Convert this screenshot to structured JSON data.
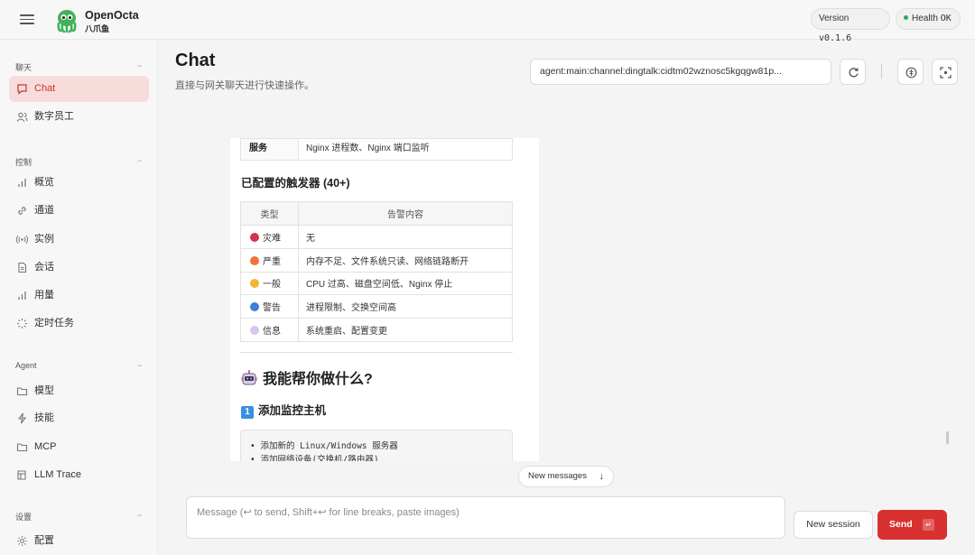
{
  "brand": {
    "name": "OpenOcta",
    "sub": "八爪鱼"
  },
  "status": {
    "version_label": "Version",
    "version_value": "v0.1.6",
    "health_label": "Health",
    "health_value": "OK",
    "health_color": "#2fa65a"
  },
  "sidebar": {
    "sections": [
      {
        "title": "聊天",
        "items": [
          {
            "label": "Chat",
            "icon": "chat-bubble-icon",
            "active": true
          },
          {
            "label": "数字员工",
            "icon": "users-icon"
          }
        ]
      },
      {
        "title": "控制",
        "items": [
          {
            "label": "概览",
            "icon": "bar-chart-icon"
          },
          {
            "label": "通道",
            "icon": "link-icon"
          },
          {
            "label": "实例",
            "icon": "radio-signal-icon"
          },
          {
            "label": "会话",
            "icon": "document-icon"
          },
          {
            "label": "用量",
            "icon": "bar-chart-icon"
          },
          {
            "label": "定时任务",
            "icon": "loader-icon"
          }
        ]
      },
      {
        "title": "Agent",
        "items": [
          {
            "label": "模型",
            "icon": "folder-icon"
          },
          {
            "label": "技能",
            "icon": "lightning-icon"
          },
          {
            "label": "MCP",
            "icon": "folder-icon"
          },
          {
            "label": "LLM Trace",
            "icon": "trace-icon"
          }
        ]
      },
      {
        "title": "设置",
        "items": [
          {
            "label": "配置",
            "icon": "gear-icon"
          }
        ]
      }
    ],
    "collapse_glyph": "−"
  },
  "header": {
    "title": "Chat",
    "subtitle": "直接与网关聊天进行快速操作。",
    "session_key": "agent:main:channel:dingtalk:cidtm02wznosc5kgqgw81p..."
  },
  "message": {
    "service_row": {
      "label": "服务",
      "value": "Nginx 进程数、Nginx 端口监听"
    },
    "triggers_heading": "已配置的触发器 (40+)",
    "table_headers": [
      "类型",
      "告警内容"
    ],
    "severity_rows": [
      {
        "level": "灾难",
        "color": "#d6334a",
        "content": "无"
      },
      {
        "level": "严重",
        "color": "#f0743a",
        "content": "内存不足、文件系统只读、网络链路断开"
      },
      {
        "level": "一般",
        "color": "#f2b63a",
        "content": "CPU 过高、磁盘空间低、Nginx 停止"
      },
      {
        "level": "警告",
        "color": "#3f7fd4",
        "content": "进程限制、交换空间高"
      },
      {
        "level": "信息",
        "color": "#d9c6ec",
        "content": "系统重启、配置变更"
      }
    ],
    "help_heading": "我能帮你做什么?",
    "step1_number": "1",
    "step1_heading": "添加监控主机",
    "code_lines": [
      "• 添加新的 Linux/Windows 服务器",
      "• 添加网络设备(交换机/路由器)"
    ]
  },
  "new_messages": {
    "label": "New messages",
    "arrow": "↓"
  },
  "composer": {
    "placeholder": "Message (↩ to send, Shift+↩ for line breaks, paste images)",
    "new_session": "New session",
    "send": "Send",
    "send_kbd": "↵"
  }
}
